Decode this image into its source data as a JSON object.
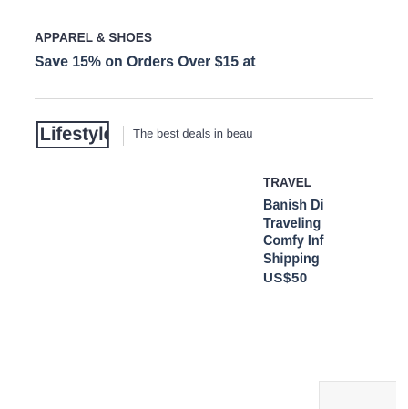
{
  "promo": {
    "category": "APPAREL & SHOES",
    "headline": "Save 15% on Orders Over $15 at"
  },
  "brand": {
    "logo_text": "Lifestyle",
    "tagline": "The best deals in beau"
  },
  "deal_card": {
    "category": "TRAVEL",
    "title_lines": [
      "Banish Di",
      "Traveling",
      "Comfy Inf",
      "Shipping"
    ],
    "price": "US$50"
  }
}
